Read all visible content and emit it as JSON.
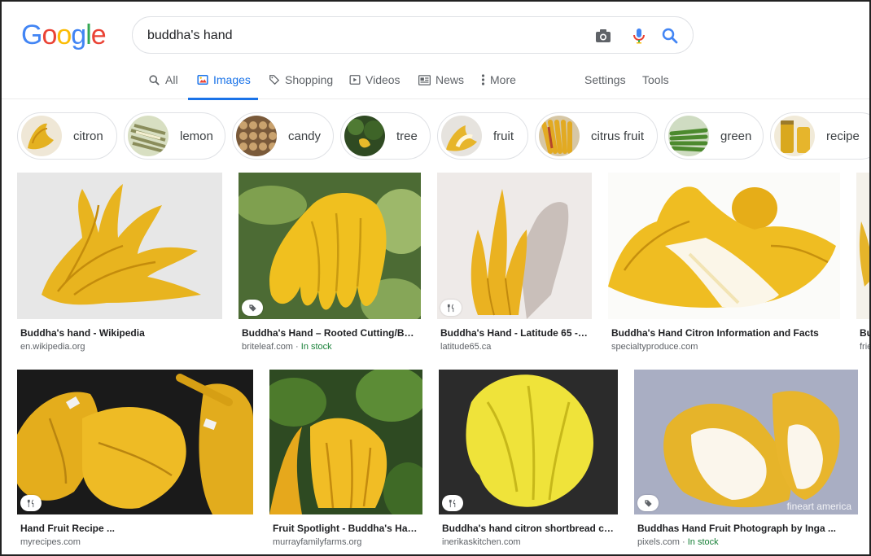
{
  "logo": {
    "letters": [
      "G",
      "o",
      "o",
      "g",
      "l",
      "e"
    ],
    "colors": [
      "#4285f4",
      "#ea4335",
      "#fbbc05",
      "#4285f4",
      "#34a853",
      "#ea4335"
    ]
  },
  "search": {
    "query": "buddha's hand",
    "icons": [
      "camera-icon",
      "microphone-icon",
      "search-icon"
    ]
  },
  "tabs": [
    {
      "label": "All",
      "icon": "search-icon"
    },
    {
      "label": "Images",
      "icon": "image-icon",
      "active": true
    },
    {
      "label": "Shopping",
      "icon": "tag-icon"
    },
    {
      "label": "Videos",
      "icon": "play-icon"
    },
    {
      "label": "News",
      "icon": "news-icon"
    },
    {
      "label": "More",
      "icon": "more-vert-icon"
    },
    {
      "label": "Settings"
    },
    {
      "label": "Tools"
    }
  ],
  "chips": [
    "citron",
    "lemon",
    "candy",
    "tree",
    "fruit",
    "citrus fruit",
    "green",
    "recipe"
  ],
  "results": [
    {
      "title": "Buddha's hand - Wikipedia",
      "source": "en.wikipedia.org"
    },
    {
      "title": "Buddha's Hand – Rooted Cutting/Bus...",
      "source": "briteleaf.com",
      "stock": "In stock",
      "badge": "tag-icon"
    },
    {
      "title": "Buddha's Hand - Latitude 65 - J...",
      "source": "latitude65.ca",
      "badge": "recipe-icon"
    },
    {
      "title": "Buddha's Hand Citron Information and Facts",
      "source": "specialtyproduce.com"
    },
    {
      "title": "Bu",
      "source": "frie"
    },
    {
      "title": "Hand Fruit Recipe ...",
      "source": "myrecipes.com",
      "badge": "recipe-icon"
    },
    {
      "title": "Fruit Spotlight - Buddha's Han...",
      "source": "murrayfamilyfarms.org"
    },
    {
      "title": "Buddha's hand citron shortbread coo...",
      "source": "inerikaskitchen.com",
      "badge": "recipe-icon"
    },
    {
      "title": "Buddhas Hand Fruit Photograph by Inga ...",
      "source": "pixels.com",
      "stock": "In stock",
      "badge": "tag-icon",
      "watermark": "fineart america"
    }
  ],
  "colors": {
    "accent": "#1a73e8",
    "in_stock": "#188038",
    "fruit": "#e9b824"
  }
}
